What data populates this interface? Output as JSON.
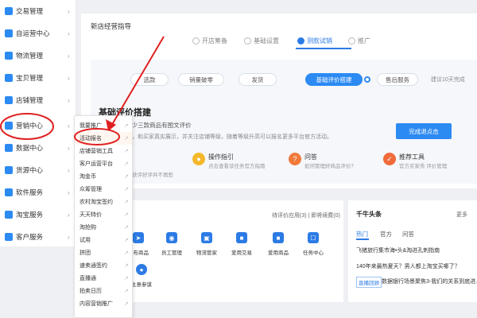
{
  "sidebar": {
    "items": [
      {
        "label": "交易管理"
      },
      {
        "label": "自运营中心"
      },
      {
        "label": "物流管理"
      },
      {
        "label": "宝贝管理"
      },
      {
        "label": "店铺管理"
      },
      {
        "label": "营销中心"
      },
      {
        "label": "数据中心"
      },
      {
        "label": "货源中心"
      },
      {
        "label": "软件服务"
      },
      {
        "label": "淘宝服务"
      },
      {
        "label": "客户服务"
      }
    ]
  },
  "flyout": {
    "items": [
      {
        "label": "我要推广"
      },
      {
        "label": "活动报名"
      },
      {
        "label": "店铺营销工具"
      },
      {
        "label": "客户运营平台"
      },
      {
        "label": "淘金币"
      },
      {
        "label": "众筹管理"
      },
      {
        "label": "农村淘宝签约"
      },
      {
        "label": "天天特价"
      },
      {
        "label": "淘抢购"
      },
      {
        "label": "试用"
      },
      {
        "label": "拼团"
      },
      {
        "label": "速卖通签约"
      },
      {
        "label": "直播通"
      },
      {
        "label": "拍卖日历"
      },
      {
        "label": "内容营销推广"
      }
    ]
  },
  "guide": {
    "title": "新店经营指导",
    "steps": [
      {
        "label": "开店筹备"
      },
      {
        "label": "基础设置"
      },
      {
        "label": "测款试销"
      },
      {
        "label": "推广"
      }
    ],
    "pills": [
      "选款",
      "销量破零",
      "发货",
      "基础评价搭建",
      "售后服务"
    ],
    "hint_right": "建议10天完成",
    "basic_title": "基础评价搭建",
    "goal": "目标: 帮助至少三款商品有图文评价",
    "goal_desc": "好的评价商品，和买家真实展示，并关注店铺等级，随着等级升高可以报名更多平台官方活动。",
    "finish_button": "完成退点击",
    "tools": [
      {
        "title": "",
        "desc": "获评好评并不再愁"
      },
      {
        "title": "操作指引",
        "desc": "点击查看该任务官方指南"
      },
      {
        "title": "问答",
        "desc": "如何管理好商品评价？"
      },
      {
        "title": "推荐工具",
        "desc": "官方买家秀 评价管理"
      }
    ]
  },
  "apps": {
    "right_text": "待评价应用(3) | 即将续费(0)",
    "items": [
      {
        "label": "发布商品"
      },
      {
        "label": "员工管理"
      },
      {
        "label": "物流管家"
      },
      {
        "label": "爱用交易"
      },
      {
        "label": "爱用商品"
      },
      {
        "label": "任务中心"
      },
      {
        "label": "生意参谋"
      }
    ]
  },
  "news": {
    "title": "千牛头条",
    "more": "更多",
    "tabs": [
      "热门",
      "官方",
      "问答"
    ],
    "lines": [
      "飞猪旅行集市海•头&淘进孔刺指南",
      "140年来最热夏天？男人都上淘宝买哪了？"
    ],
    "badge": "直播回顾",
    "last_line": "数据银行场景聚焦3-我们的关系到底进..."
  },
  "colors": {
    "accent": "#2c8af3",
    "annotation": "#e02020"
  }
}
